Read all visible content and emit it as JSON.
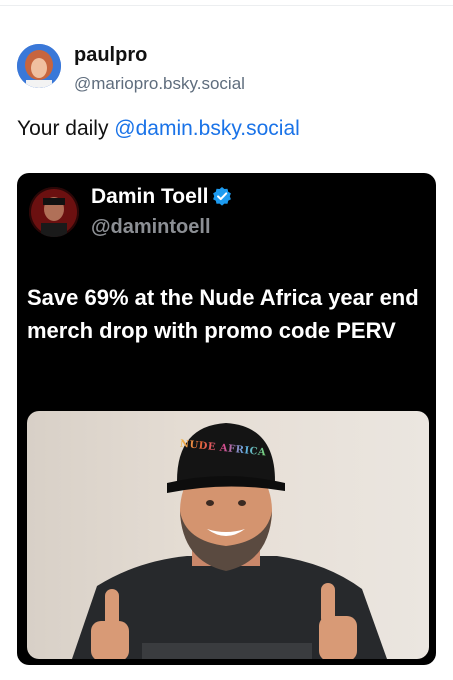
{
  "post": {
    "author_name": "paulpro",
    "author_handle": "@mariopro.bsky.social",
    "text_prefix": "Your daily ",
    "mention": "@damin.bsky.social"
  },
  "embed": {
    "name": "Damin Toell",
    "handle": "@damintoell",
    "text": "Save 69% at the Nude Africa year end merch drop with promo code PERV",
    "hat_text": "NUDE AFRICA",
    "verified_color": "#1d9bf0"
  },
  "colors": {
    "mention": "#1a73e8",
    "handle_gray": "#5f6d7d"
  },
  "icons": {
    "verified": "verified-badge-icon"
  }
}
